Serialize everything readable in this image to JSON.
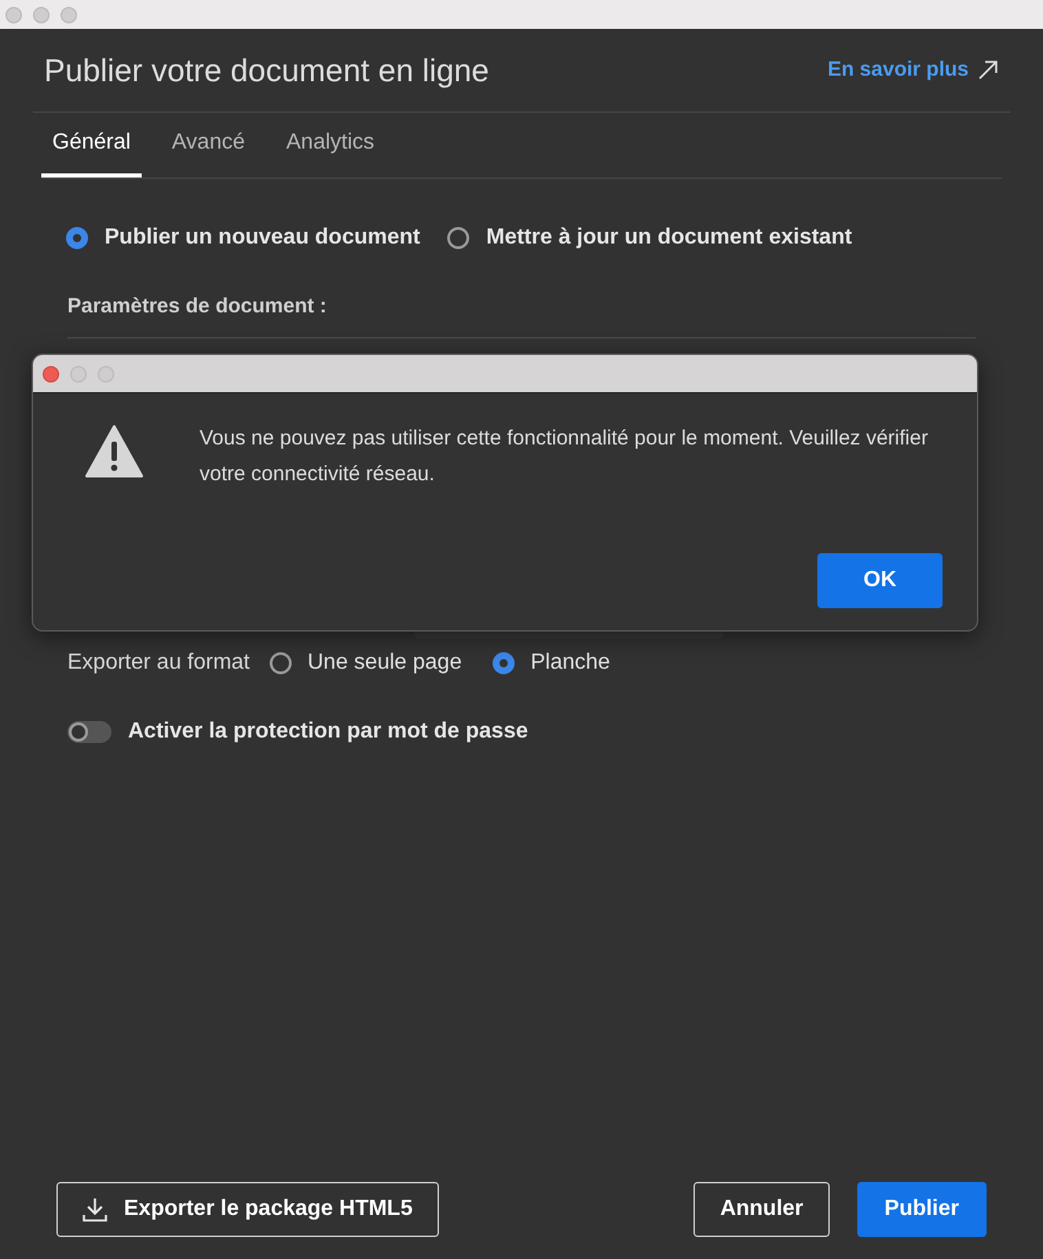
{
  "window": {
    "title": "Publier votre document en ligne",
    "help_link": "En savoir plus"
  },
  "tabs": [
    {
      "label": "Général",
      "selected": true
    },
    {
      "label": "Avancé",
      "selected": false
    },
    {
      "label": "Analytics",
      "selected": false
    }
  ],
  "publish_mode": [
    {
      "label": "Publier un nouveau document",
      "selected": true
    },
    {
      "label": "Mettre à jour un document existant",
      "selected": false
    }
  ],
  "section_label": "Paramètres de document :",
  "export_format": {
    "label": "Exporter au format",
    "options": [
      {
        "label": "Une seule page",
        "selected": false
      },
      {
        "label": "Planche",
        "selected": true
      }
    ]
  },
  "password_toggle": {
    "label": "Activer la protection par mot de passe",
    "on": false
  },
  "footer": {
    "export_button": "Exporter le package HTML5",
    "cancel_button": "Annuler",
    "publish_button": "Publier"
  },
  "alert": {
    "message": "Vous ne pouvez pas utiliser cette fonctionnalité pour le moment. Veuillez vérifier votre connectivité réseau.",
    "ok_button": "OK"
  }
}
